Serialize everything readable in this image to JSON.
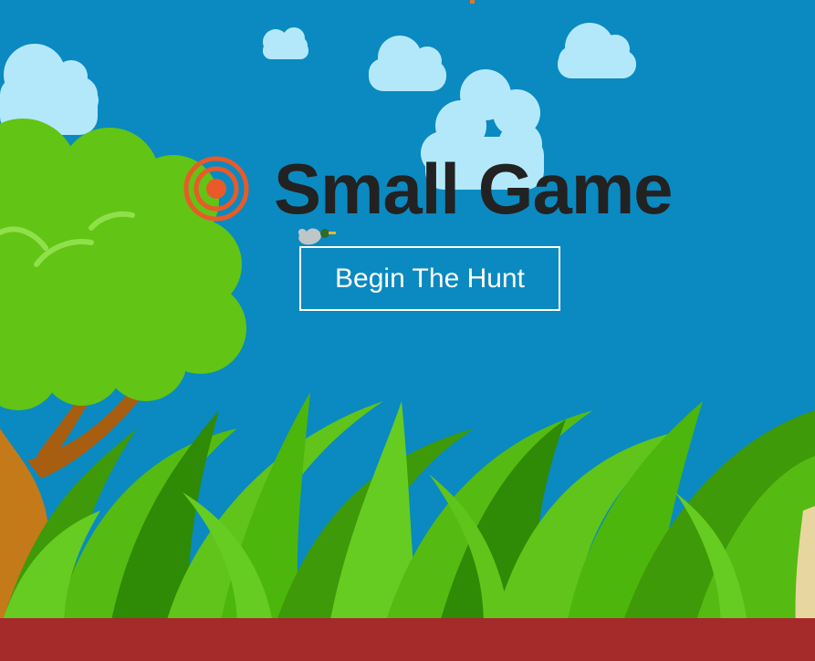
{
  "game": {
    "title": "Small Game",
    "start_button_label": "Begin The Hunt"
  },
  "icons": {
    "logo": "target-icon",
    "duck": "duck-icon"
  },
  "colors": {
    "sky": "#0a8ac0",
    "cloud": "#b3e8fb",
    "title": "#222222",
    "target": "#e85a2a",
    "tree_foliage": "#62c414",
    "tree_trunk": "#c47a18",
    "grass": "#4cb60c",
    "ground": "#a52a2a"
  }
}
